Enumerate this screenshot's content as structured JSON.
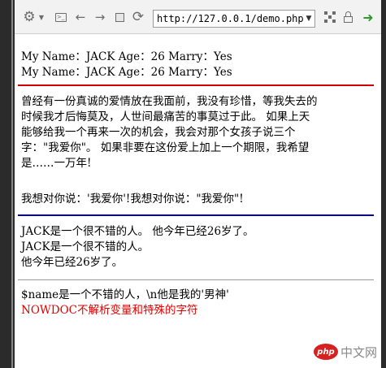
{
  "browser": {
    "url": "http://127.0.0.1/demo.php",
    "icons": {
      "settings": "gear-icon",
      "settings_menu": "chevron-down-icon",
      "devtools": "devtools-icon",
      "back": "arrow-left-icon",
      "forward": "arrow-right-icon",
      "stop": "stop-icon",
      "reload": "reload-icon",
      "url_dropdown": "chevron-down-icon",
      "qr": "qr-code-icon",
      "lock": "lock-icon",
      "go": "go-arrow-icon"
    }
  },
  "page": {
    "line1": "My Name：JACK Age：26 Marry：Yes",
    "line2": "My Name：JACK Age：26 Marry：Yes",
    "paragraph_lines": [
      "曾经有一份真诚的爱情放在我面前，我没有珍惜，等我失去的",
      "时候我才后悔莫及，人世间最痛苦的事莫过于此。 如果上天",
      "能够给我一个再来一次的机会，我会对那个女孩子说三个",
      "字：\"我爱你\"。 如果非要在这份爱上加上一个期限，我希望",
      "是……一万年!"
    ],
    "quote_line": "我想对你说：'我爱你'!我想对你说：\"我爱你\"!",
    "jack_lines": [
      "JACK是一个很不错的人。 他今年已经26岁了。",
      "JACK是一个很不错的人。",
      "他今年已经26岁了。"
    ],
    "nowdoc_line": "$name是一个不错的人，\\n他是我的'男神'",
    "nowdoc_red": "NOWDOC不解析变量和特殊的字符"
  },
  "colors": {
    "rule_red": "#cc0000",
    "rule_blue": "#000080",
    "rule_gray": "#999999",
    "red_text": "#e00000"
  },
  "watermark": {
    "logo": "php",
    "text": "中文网"
  }
}
